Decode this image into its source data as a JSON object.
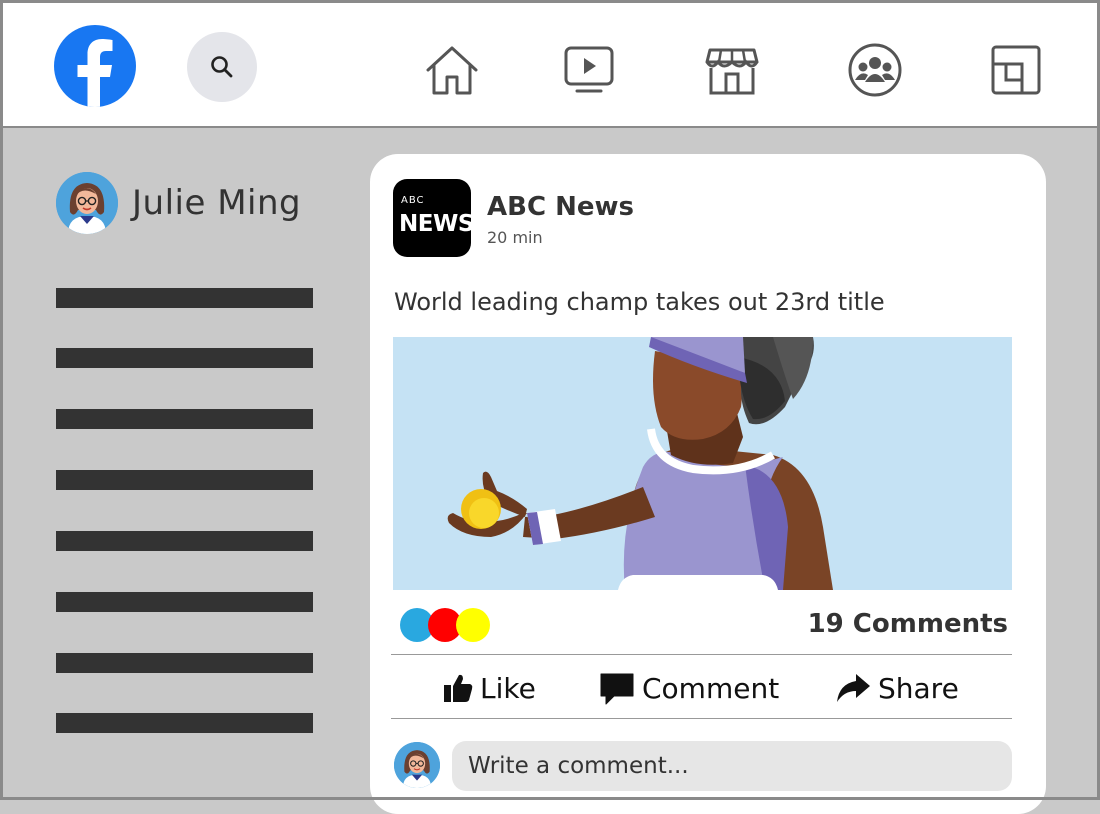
{
  "app": {
    "accent": "#1877f2"
  },
  "header": {
    "logo_icon": "facebook-logo-icon",
    "search_icon": "search-icon",
    "nav": [
      {
        "name": "home",
        "icon": "home-icon"
      },
      {
        "name": "watch",
        "icon": "video-icon"
      },
      {
        "name": "marketplace",
        "icon": "store-icon"
      },
      {
        "name": "groups",
        "icon": "groups-icon"
      },
      {
        "name": "gaming",
        "icon": "gaming-icon"
      }
    ]
  },
  "sidebar": {
    "user_name": "Julie Ming",
    "menu_item_count_visible": 8
  },
  "post": {
    "page_name": "ABC News",
    "logo_small_text": "ABC",
    "logo_text": "NEWS",
    "time": "20 min",
    "text": "World leading champ takes out 23rd title",
    "reaction_colors": [
      "#29a8e0",
      "#ff0000",
      "#ffff00"
    ],
    "comments_label": "19 Comments",
    "actions": {
      "like": "Like",
      "comment": "Comment",
      "share": "Share"
    },
    "comment_placeholder": "Write a comment..."
  }
}
